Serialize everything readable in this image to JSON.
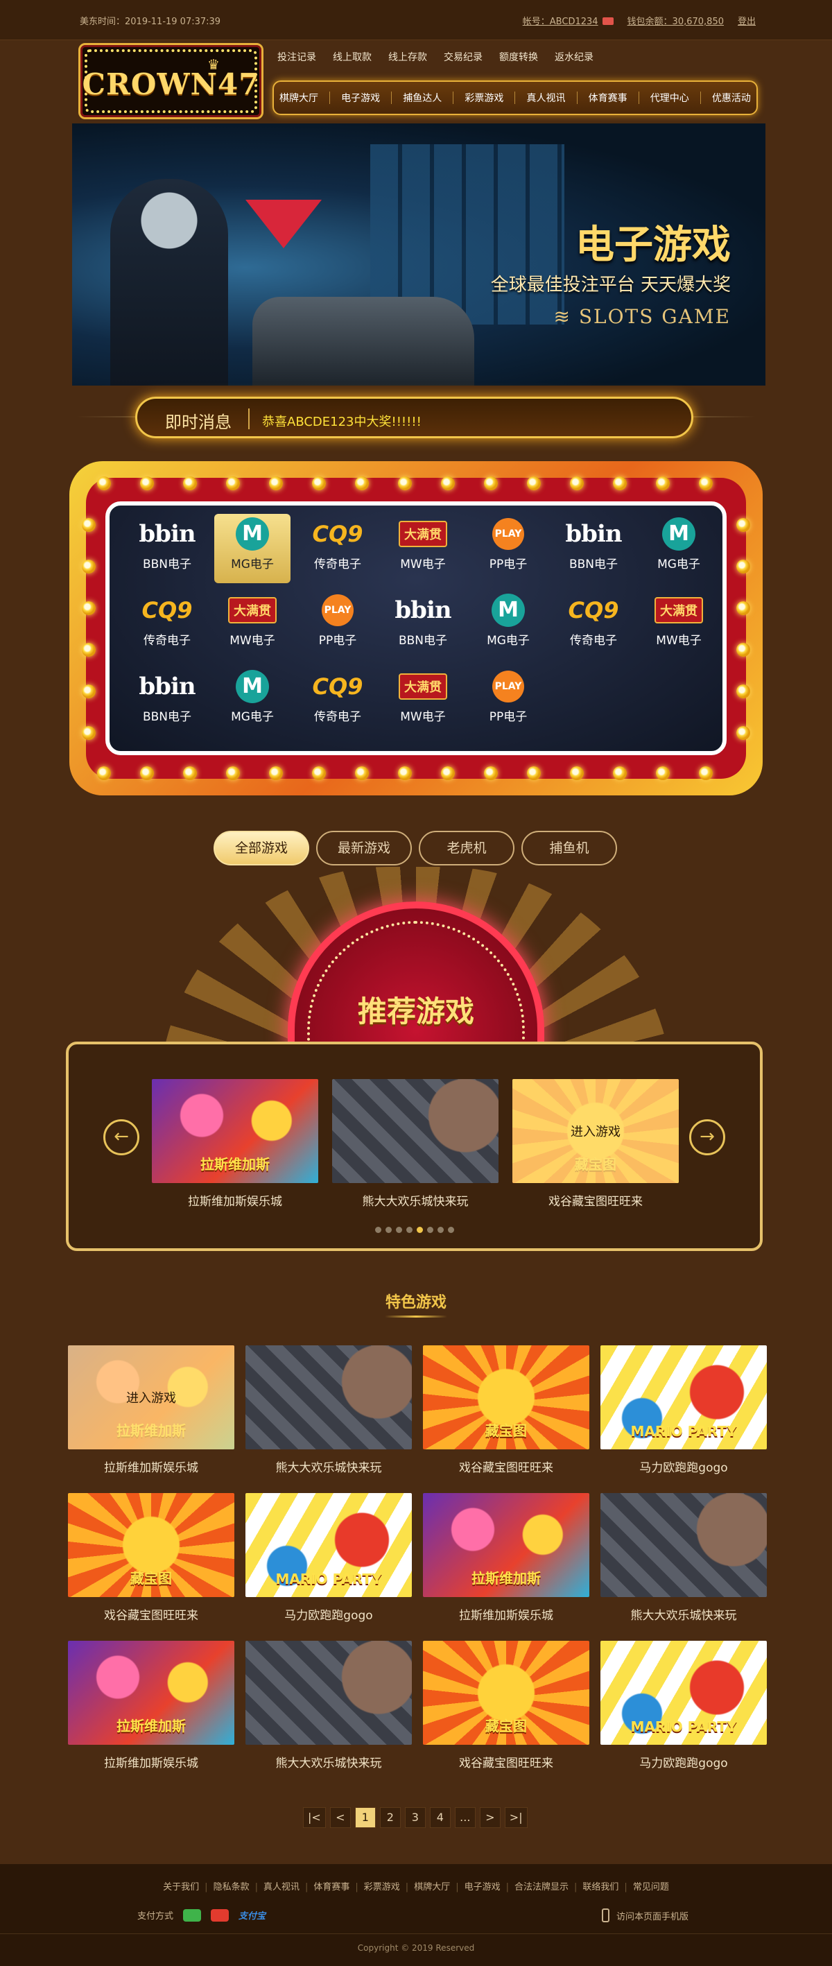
{
  "topbar": {
    "time_label": "美东时间：2019-11-19 07:37:39",
    "account_label": "帐号：ABCD1234",
    "balance_label": "钱包余额：30,670,850",
    "logout": "登出"
  },
  "logo": {
    "text": "CROWN47"
  },
  "subnav": [
    "投注记录",
    "线上取款",
    "线上存款",
    "交易纪录",
    "额度转换",
    "返水纪录"
  ],
  "mainnav": [
    "棋牌大厅",
    "电子游戏",
    "捕鱼达人",
    "彩票游戏",
    "真人视讯",
    "体育赛事",
    "代理中心",
    "优惠活动"
  ],
  "banner": {
    "title": "电子游戏",
    "subtitle": "全球最佳投注平台 天天爆大奖",
    "en": "SLOTS GAME"
  },
  "news": {
    "label": "即时消息",
    "message": "恭喜ABCDE123中大奖!!!!!!"
  },
  "platforms": [
    {
      "icon": "bbin",
      "logo": "bbin",
      "name": "BBN电子"
    },
    {
      "icon": "mg",
      "logo": "M",
      "name": "MG电子"
    },
    {
      "icon": "cq9",
      "logo": "CQ9",
      "name": "传奇电子"
    },
    {
      "icon": "mw",
      "logo": "大满贯",
      "name": "MW电子"
    },
    {
      "icon": "pp",
      "logo": "PLAY",
      "name": "PP电子"
    },
    {
      "icon": "bbin",
      "logo": "bbin",
      "name": "BBN电子"
    },
    {
      "icon": "mg",
      "logo": "M",
      "name": "MG电子"
    },
    {
      "icon": "cq9",
      "logo": "CQ9",
      "name": "传奇电子"
    },
    {
      "icon": "mw",
      "logo": "大满贯",
      "name": "MW电子"
    },
    {
      "icon": "pp",
      "logo": "PLAY",
      "name": "PP电子"
    },
    {
      "icon": "bbin",
      "logo": "bbin",
      "name": "BBN电子"
    },
    {
      "icon": "mg",
      "logo": "M",
      "name": "MG电子"
    },
    {
      "icon": "cq9",
      "logo": "CQ9",
      "name": "传奇电子"
    },
    {
      "icon": "mw",
      "logo": "大满贯",
      "name": "MW电子"
    },
    {
      "icon": "bbin",
      "logo": "bbin",
      "name": "BBN电子"
    },
    {
      "icon": "mg",
      "logo": "M",
      "name": "MG电子"
    },
    {
      "icon": "cq9",
      "logo": "CQ9",
      "name": "传奇电子"
    },
    {
      "icon": "mw",
      "logo": "大满贯",
      "name": "MW电子"
    },
    {
      "icon": "pp",
      "logo": "PLAY",
      "name": "PP电子"
    }
  ],
  "selected_platform": 1,
  "tabs": [
    "全部游戏",
    "最新游戏",
    "老虎机",
    "捕鱼机"
  ],
  "active_tab": 0,
  "reco": {
    "title": "推荐游戏",
    "enter_label": "进入游戏",
    "items": [
      {
        "name": "拉斯维加斯娱乐城",
        "art": "g-lasvegas",
        "art_text": "拉斯维加斯"
      },
      {
        "name": "熊大大欢乐城快来玩",
        "art": "g-bear",
        "art_text": ""
      },
      {
        "name": "戏谷藏宝图旺旺来",
        "art": "g-treasure",
        "art_text": "藏宝图"
      }
    ],
    "hover_index": 2,
    "dot_count": 8,
    "active_dot": 4
  },
  "featured": {
    "title": "特色游戏",
    "enter_label": "进入游戏",
    "items": [
      {
        "name": "拉斯维加斯娱乐城",
        "art": "g-lasvegas",
        "art_text": "拉斯维加斯"
      },
      {
        "name": "熊大大欢乐城快来玩",
        "art": "g-bear",
        "art_text": ""
      },
      {
        "name": "戏谷藏宝图旺旺来",
        "art": "g-treasure",
        "art_text": "藏宝图"
      },
      {
        "name": "马力欧跑跑gogo",
        "art": "g-mario",
        "art_text": "MARIO PARTY"
      },
      {
        "name": "戏谷藏宝图旺旺来",
        "art": "g-treasure",
        "art_text": "藏宝图"
      },
      {
        "name": "马力欧跑跑gogo",
        "art": "g-mario",
        "art_text": "MARIO PARTY"
      },
      {
        "name": "拉斯维加斯娱乐城",
        "art": "g-lasvegas",
        "art_text": "拉斯维加斯"
      },
      {
        "name": "熊大大欢乐城快来玩",
        "art": "g-bear",
        "art_text": ""
      },
      {
        "name": "拉斯维加斯娱乐城",
        "art": "g-lasvegas",
        "art_text": "拉斯维加斯"
      },
      {
        "name": "熊大大欢乐城快来玩",
        "art": "g-bear",
        "art_text": ""
      },
      {
        "name": "戏谷藏宝图旺旺来",
        "art": "g-treasure",
        "art_text": "藏宝图"
      },
      {
        "name": "马力欧跑跑gogo",
        "art": "g-mario",
        "art_text": "MARIO PARTY"
      }
    ],
    "hover_index": 0
  },
  "pager": [
    "|<",
    "<",
    "1",
    "2",
    "3",
    "4",
    "...",
    ">",
    ">|"
  ],
  "current_page": "1",
  "footer": {
    "links": [
      "关于我们",
      "隐私条款",
      "真人视讯",
      "体育赛事",
      "彩票游戏",
      "棋牌大厅",
      "电子游戏",
      "合法法牌显示",
      "联络我们",
      "常见问题"
    ],
    "pay_label": "支付方式",
    "alipay": "支付宝",
    "mobile_label": "访问本页面手机版",
    "copyright": "Copyright © 2019 Reserved"
  },
  "colors": {
    "accent": "#f2c64a",
    "background": "#4a2b12",
    "marquee_red": "#b6101e"
  }
}
